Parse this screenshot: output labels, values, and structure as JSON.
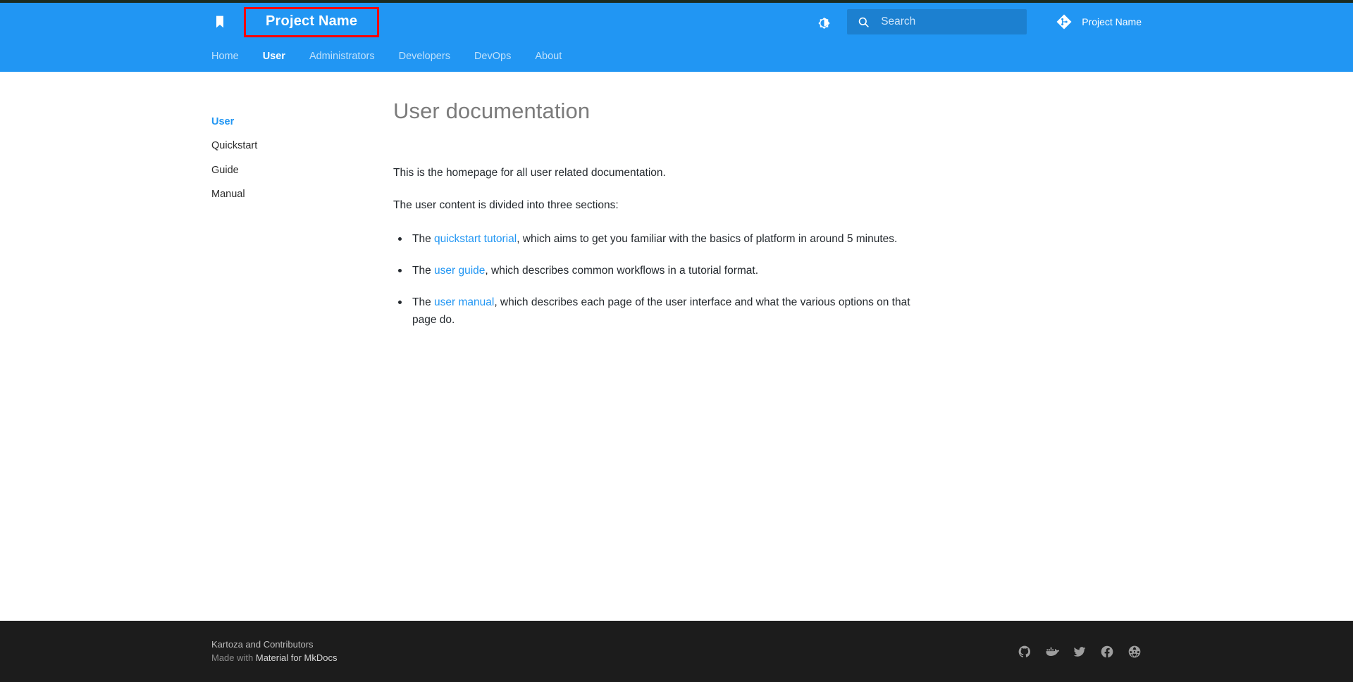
{
  "header": {
    "logo_icon": "book-icon",
    "site_title": "Project Name",
    "palette_toggle_icon": "brightness-contrast-icon",
    "search": {
      "icon": "search-icon",
      "placeholder": "Search",
      "value": ""
    },
    "repo": {
      "icon": "git-icon",
      "label": "Project Name"
    }
  },
  "tabs": [
    {
      "label": "Home",
      "active": false
    },
    {
      "label": "User",
      "active": true
    },
    {
      "label": "Administrators",
      "active": false
    },
    {
      "label": "Developers",
      "active": false
    },
    {
      "label": "DevOps",
      "active": false
    },
    {
      "label": "About",
      "active": false
    }
  ],
  "sidebar": {
    "items": [
      {
        "label": "User",
        "active": true
      },
      {
        "label": "Quickstart",
        "active": false
      },
      {
        "label": "Guide",
        "active": false
      },
      {
        "label": "Manual",
        "active": false
      }
    ]
  },
  "main": {
    "title": "User documentation",
    "paragraph_1": "This is the homepage for all user related documentation.",
    "paragraph_2": "The user content is divided into three sections:",
    "bullets": [
      {
        "prefix": "The ",
        "link": "quickstart tutorial",
        "suffix": ", which aims to get you familiar with the basics of platform in around 5 minutes."
      },
      {
        "prefix": "The ",
        "link": "user guide",
        "suffix": ", which describes common workflows in a tutorial format."
      },
      {
        "prefix": "The ",
        "link": "user manual",
        "suffix": ", which describes each page of the user interface and what the various options on that page do."
      }
    ]
  },
  "footer": {
    "copyright": "Kartoza and Contributors",
    "generator_prefix": "Made with ",
    "generator_name": "Material for MkDocs",
    "social": [
      {
        "name": "github-icon"
      },
      {
        "name": "docker-icon"
      },
      {
        "name": "twitter-icon"
      },
      {
        "name": "facebook-icon"
      },
      {
        "name": "globe-icon"
      }
    ]
  },
  "colors": {
    "primary": "#2196f3",
    "accent_link": "#2196f3",
    "highlight_box": "#ff0000",
    "footer_bg": "#1c1c1c",
    "top_strip": "#1b2b20"
  }
}
